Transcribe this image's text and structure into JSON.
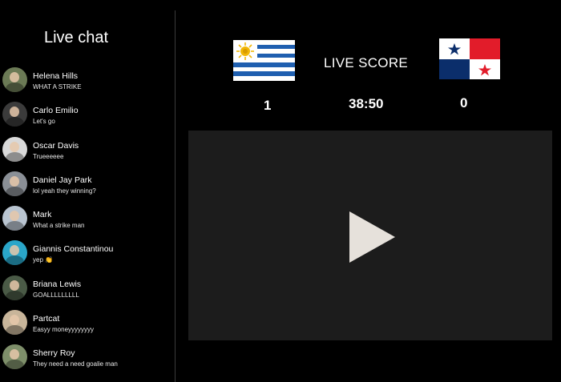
{
  "chat": {
    "title": "Live chat",
    "messages": [
      {
        "name": "Helena Hills",
        "text": "WHAT A STRIKE",
        "avatar_color": "#6b7a55"
      },
      {
        "name": "Carlo Emilio",
        "text": "Let's go",
        "avatar_color": "#3b3b3b"
      },
      {
        "name": "Oscar Davis",
        "text": "Trueeeeee",
        "avatar_color": "#d9d9d9"
      },
      {
        "name": "Daniel Jay Park",
        "text": "lol yeah they winning?",
        "avatar_color": "#8a8f96"
      },
      {
        "name": "Mark",
        "text": "What a strike man",
        "avatar_color": "#b9c4d0"
      },
      {
        "name": "Giannis Constantinou",
        "text": "yep 👏",
        "avatar_color": "#2aa6c9"
      },
      {
        "name": "Briana Lewis",
        "text": "GOALLLLLLLLL",
        "avatar_color": "#4a5a46"
      },
      {
        "name": "Partcat",
        "text": "Easyy moneyyyyyyyy",
        "avatar_color": "#c8b59a"
      },
      {
        "name": "Sherry Roy",
        "text": "They need a need goalie man",
        "avatar_color": "#7e8f6a"
      }
    ]
  },
  "match": {
    "title": "LIVE SCORE",
    "time": "38:50",
    "home": {
      "flag": "uruguay-flag",
      "score": "1"
    },
    "away": {
      "flag": "panama-flag",
      "score": "0"
    }
  },
  "player": {
    "icon": "play-icon"
  },
  "colors": {
    "background": "#000000",
    "video_bg": "#1c1c1c",
    "play": "#e6e1db",
    "uruguay_blue": "#1f5fb0",
    "uruguay_sun": "#f2b705",
    "panama_red": "#e21c2a",
    "panama_blue": "#0b2e6b"
  }
}
